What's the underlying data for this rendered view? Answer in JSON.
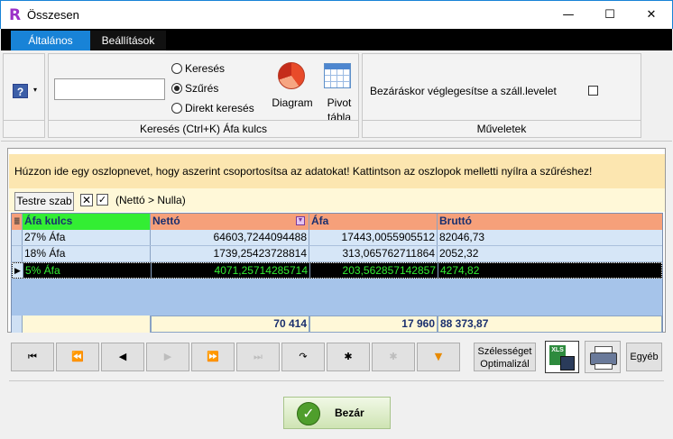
{
  "window": {
    "logo": "R",
    "title": "Összesen",
    "minimize_glyph": "—",
    "maximize_glyph": "☐",
    "close_glyph": "✕"
  },
  "tabs": [
    {
      "label": "Általános",
      "active": true
    },
    {
      "label": "Beállítások",
      "active": false
    }
  ],
  "ribbon": {
    "search_group": {
      "caption": "Keresés (Ctrl+K) Áfa kulcs",
      "input_value": "",
      "radios": [
        {
          "label": "Keresés",
          "checked": false
        },
        {
          "label": "Szűrés",
          "checked": true
        },
        {
          "label": "Direkt keresés",
          "checked": false
        }
      ],
      "diagram_label": "Diagram",
      "pivot_label_line1": "Pivot",
      "pivot_label_line2": "tábla"
    },
    "help_icon_text": "?",
    "help_arrow": "▾",
    "operations_group": {
      "caption": "Műveletek",
      "checkbox_label": "Bezáráskor véglegesítse a száll.levelet",
      "checkbox_checked": false
    }
  },
  "grid_panel": {
    "group_hint": "Húzzon ide egy oszlopnevet, hogy aszerint csoportosítsa az adatokat! Kattintson az oszlopok melletti nyílra a szűréshez!",
    "customize_button": "Testre szab",
    "filter_clear_glyph": "✕",
    "filter_check_glyph": "✓",
    "filter_text": "(Nettó > Nulla)",
    "columns": [
      "Áfa kulcs",
      "Nettó",
      "Áfa",
      "Bruttó"
    ],
    "rows": [
      {
        "afa_kulcs": "27% Áfa",
        "netto": "64603,7244094488",
        "afa": "17443,0055905512",
        "brutto": "82046,73",
        "selected": false
      },
      {
        "afa_kulcs": "18% Áfa",
        "netto": "1739,25423728814",
        "afa": "313,065762711864",
        "brutto": "2052,32",
        "selected": false
      },
      {
        "afa_kulcs": "5% Áfa",
        "netto": "4071,25714285714",
        "afa": "203,562857142857",
        "brutto": "4274,82",
        "selected": true
      }
    ],
    "footer": {
      "netto": "70 414",
      "afa": "17 960",
      "brutto": "88 373,87"
    },
    "current_row_glyph": "▶"
  },
  "navigator": {
    "buttons": [
      {
        "name": "first",
        "glyph": "⏮",
        "enabled": true
      },
      {
        "name": "prev-page",
        "glyph": "⏪",
        "enabled": true
      },
      {
        "name": "prev",
        "glyph": "◀",
        "enabled": true
      },
      {
        "name": "next",
        "glyph": "▶",
        "enabled": false
      },
      {
        "name": "next-page",
        "glyph": "⏩",
        "enabled": false
      },
      {
        "name": "last",
        "glyph": "⏭",
        "enabled": false
      },
      {
        "name": "refresh",
        "glyph": "↷",
        "enabled": true
      },
      {
        "name": "insert",
        "glyph": "✱",
        "enabled": true
      },
      {
        "name": "delete",
        "glyph": "✱",
        "enabled": false
      },
      {
        "name": "filter",
        "glyph": "▼",
        "enabled": true
      }
    ],
    "width_button_line1": "Szélességet",
    "width_button_line2": "Optimalizál",
    "xls_label": "XLS",
    "other_button": "Egyéb"
  },
  "close_button": {
    "label": "Bezár",
    "glyph": "✓"
  },
  "colors": {
    "accent": "#1883d7",
    "header_row": "#f6a07a",
    "first_header": "#33ee33",
    "selected_row": "#000000",
    "hint_bar": "#fce6b0"
  }
}
